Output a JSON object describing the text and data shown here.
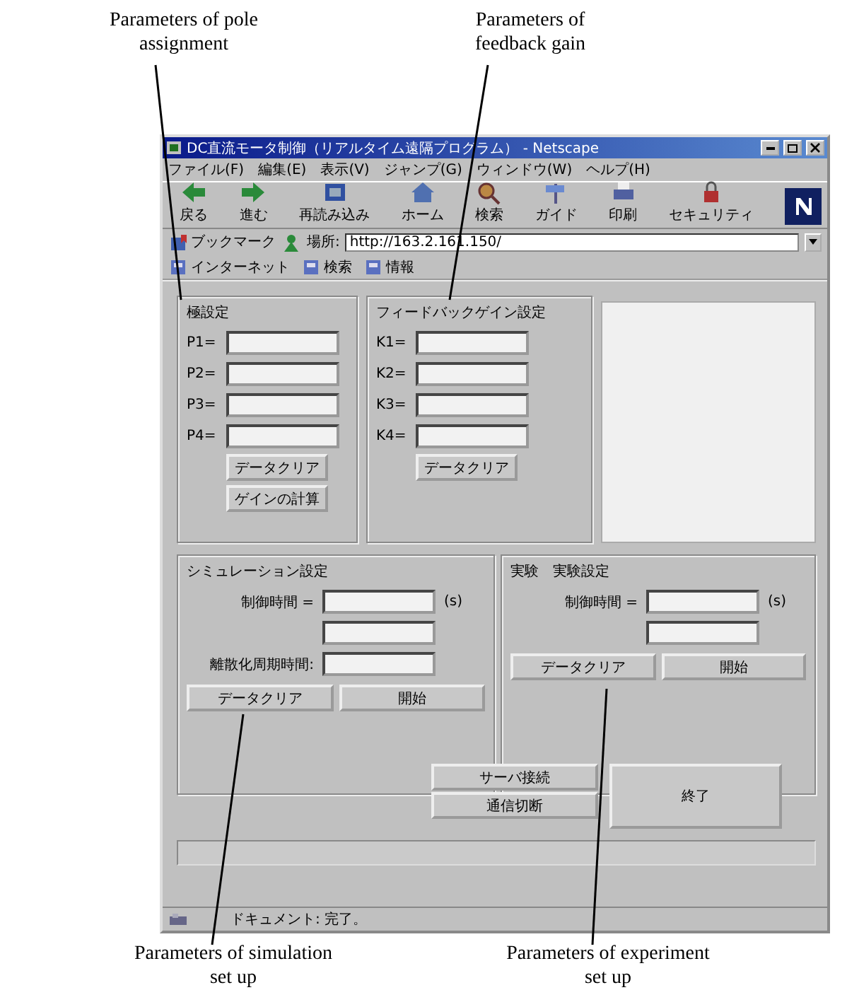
{
  "top_annotations": [
    {
      "text": "Parameters of pole assignment"
    },
    {
      "text": "Parameters of feedback gain"
    }
  ],
  "window": {
    "title": "DC直流モータ制御（リアルタイム遠隔プログラム） - Netscape"
  },
  "menu": [
    "ファイル(F)",
    "編集(E)",
    "表示(V)",
    "ジャンプ(G)",
    "ウィンドウ(W)",
    "ヘルプ(H)"
  ],
  "toolbar": [
    "戻る",
    "進む",
    "再読み込み",
    "ホーム",
    "検索",
    "ガイド",
    "印刷",
    "セキュリティ"
  ],
  "location_bar": {
    "bookmarks_label": "ブックマーク",
    "location_label": "場所:",
    "url": "http://163.2.161.150/"
  },
  "personal_toolbar": [
    "インターネット",
    "検索",
    "情報"
  ],
  "pole_settings": {
    "title": "極設定",
    "fields": [
      "P1=",
      "P2=",
      "P3=",
      "P4="
    ],
    "buttons": [
      "データクリア",
      "ゲインの計算"
    ]
  },
  "feedback_settings": {
    "title": "フィードバックゲイン設定",
    "fields": [
      "K1=",
      "K2=",
      "K3=",
      "K4="
    ],
    "buttons": [
      "データクリア"
    ]
  },
  "simulation_settings": {
    "title": "シミュレーション設定",
    "rows": [
      {
        "kind": "labeled",
        "label": "制御時間 =",
        "unit": "(s)"
      },
      {
        "kind": "plain"
      },
      {
        "kind": "labeled",
        "label": "離散化周期時間:"
      }
    ],
    "buttons": [
      "データクリア",
      "開始"
    ]
  },
  "experiment_settings": {
    "title": "実験　実験設定",
    "rows": [
      {
        "kind": "labeled",
        "label": "制御時間 =",
        "unit": "(s)"
      },
      {
        "kind": "plain"
      }
    ],
    "buttons": [
      "データクリア",
      "開始"
    ]
  },
  "connection_buttons": [
    "サーバ接続",
    "通信切断"
  ],
  "exit_button": "終了",
  "status_bar": {
    "text": "ドキュメント: 完了。"
  },
  "bottom_annotations": [
    {
      "text": "Parameters of simulation set up"
    },
    {
      "text": "Parameters of experiment set up"
    }
  ]
}
